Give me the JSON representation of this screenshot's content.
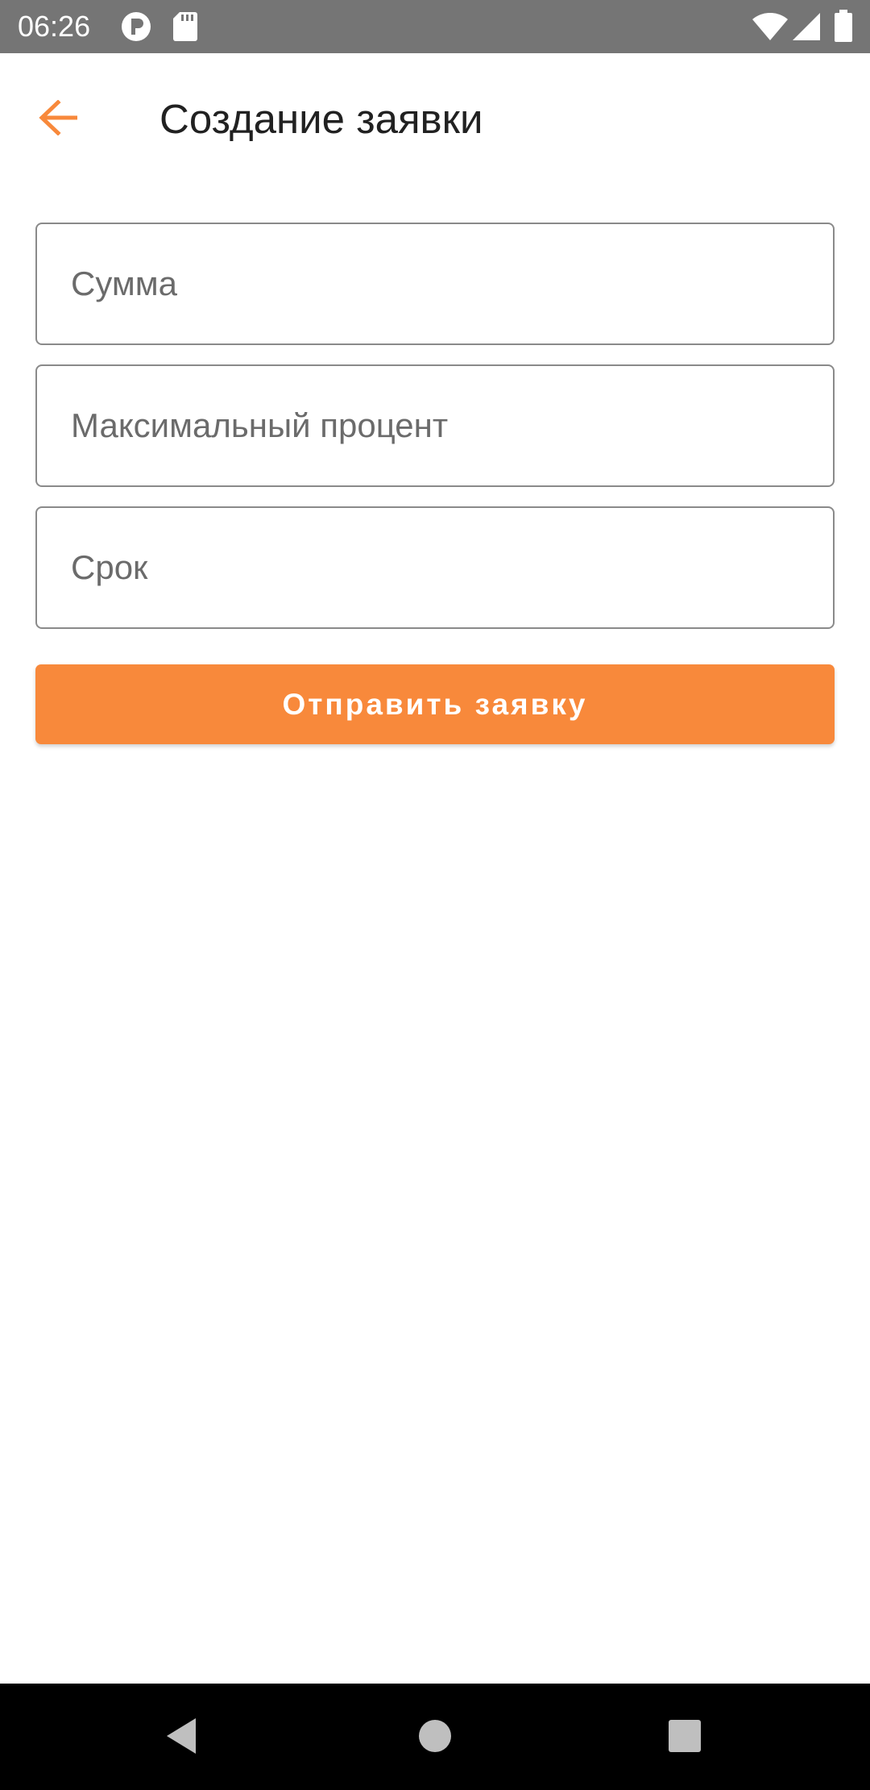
{
  "status_bar": {
    "time": "06:26",
    "icons": [
      "p-notification-icon",
      "sd-card-icon",
      "wifi-icon",
      "cell-signal-icon",
      "battery-icon"
    ]
  },
  "toolbar": {
    "back_icon": "arrow-left-icon",
    "title": "Создание заявки"
  },
  "form": {
    "amount_placeholder": "Сумма",
    "max_percent_placeholder": "Максимальный процент",
    "term_placeholder": "Срок",
    "submit_label": "Отправить заявку"
  },
  "nav_bar": {
    "buttons": [
      "back-triangle-icon",
      "home-circle-icon",
      "recents-square-icon"
    ]
  },
  "colors": {
    "accent": "#f8893b",
    "status_bar": "#757575",
    "nav_bar": "#000000",
    "field_border": "#8a8a8a"
  }
}
